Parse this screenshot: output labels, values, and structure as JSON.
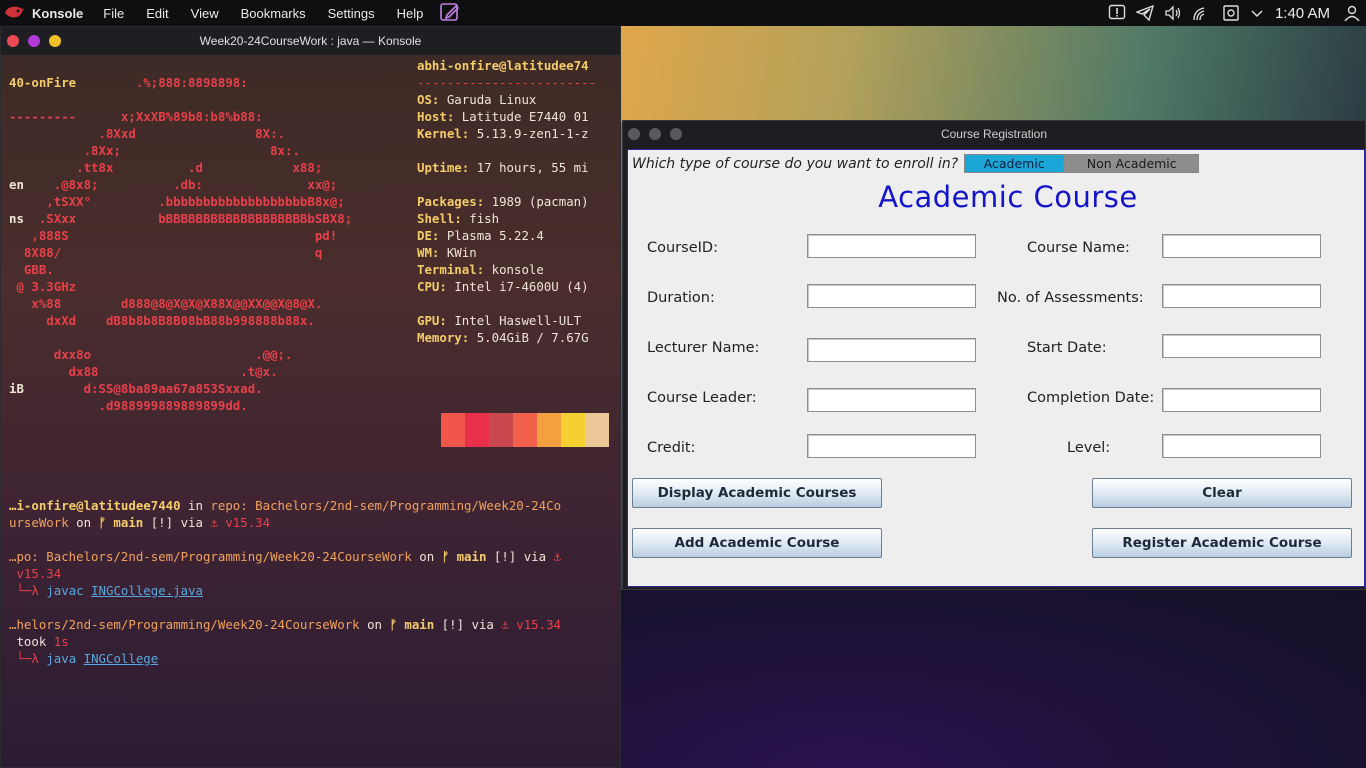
{
  "topbar": {
    "app_name": "Konsole",
    "menus": [
      "File",
      "Edit",
      "View",
      "Bookmarks",
      "Settings",
      "Help"
    ],
    "clock": "1:40 AM"
  },
  "konsole": {
    "title": "Week20-24CourseWork : java — Konsole",
    "ascii_art": "\n                 .%;888:8898898:\n\n               x;XxXB%89b8:b8%b88:\n            .8Xxd                8X:.\n          .8Xx;                    8x:.\n         .tt8x          .d            x88;\n      .@8x8;          .db:              xx@;\n     ,tSXX°         .bbbbbbbbbbbbbbbbbbbB8x@;\n    .SXxx           bBBBBBBBBBBBBBBBBBBBbSBX8;\n   ,888S                                 pd!\n  8X88/                                  q\n  GBB.\n @ 3.3GHz\n   x%88        d888@8@X@X@X88X@@XX@@X@8@X.\n     dxXd    dB8b8b8B8B08bB88b998888b88x.\n\n      dxx8o                      .@@;.\n        dx88                   .t@x.\n          d:SS@8ba89aa67a853Sxxad.\n            .d988999889889899dd.",
    "ascii_wrap": [
      "40-onFire",
      "---------",
      "en",
      "ns",
      "iB"
    ],
    "info": {
      "user": "abhi-onfire@latitudee74",
      "separator": "------------------------",
      "lines": [
        {
          "k": "OS",
          "v": " Garuda Linux"
        },
        {
          "k": "Host",
          "v": " Latitude E7440 01"
        },
        {
          "k": "Kernel",
          "v": " 5.13.9-zen1-1-z"
        },
        {
          "k": "Uptime",
          "v": " 17 hours, 55 mi"
        },
        {
          "k": "Packages",
          "v": " 1989 (pacman)"
        },
        {
          "k": "Shell",
          "v": " fish"
        },
        {
          "k": "DE",
          "v": " Plasma 5.22.4"
        },
        {
          "k": "WM",
          "v": " KWin"
        },
        {
          "k": "Terminal",
          "v": " konsole"
        },
        {
          "k": "CPU",
          "v": " Intel i7-4600U (4)"
        },
        {
          "k": "GPU",
          "v": " Intel Haswell-ULT"
        },
        {
          "k": "Memory",
          "v": " 5.04GiB / 7.67G"
        }
      ]
    },
    "palette": [
      "#f0574a",
      "#e8304a",
      "#c8484d",
      "#f0604a",
      "#f2a040",
      "#f5d030",
      "#ecc898"
    ],
    "prompt1_a": "…i-onfire@latitudee7440",
    "prompt1_b": " in ",
    "prompt1_c": "repo: Bachelors/2nd-sem/Programming/Week20-24Co",
    "prompt1_d": "urseWork",
    "prompt1_e": " on ",
    "prompt1_f": "ᚠ main",
    "prompt1_g": " [!] via ",
    "prompt1_h": "⚓ v15.34",
    "prompt2_a": "…po: Bachelors/2nd-sem/Programming/Week20-24CourseWork",
    "prompt2_b": " on ",
    "prompt2_c": "ᚠ main",
    "prompt2_d": " [!] via ",
    "prompt2_e": "⚓",
    "prompt2_f": " v15.34",
    "cmd1_prefix": " └─λ ",
    "cmd1_cmd": "javac",
    "cmd1_arg": "INGCollege.java",
    "prompt3_a": "…helors/2nd-sem/Programming/Week20-24CourseWork",
    "prompt3_b": " on ",
    "prompt3_c": "ᚠ main",
    "prompt3_d": " [!] via ",
    "prompt3_e": "⚓ v15.34",
    "took_a": " took ",
    "took_b": "1s",
    "cmd2_prefix": " └─λ ",
    "cmd2_cmd": "java",
    "cmd2_arg": "INGCollege"
  },
  "course_app": {
    "title": "Course Registration",
    "question": "Which type of course do you want to enroll in?",
    "tabs": [
      "Academic",
      "Non Academic"
    ],
    "heading": "Academic Course",
    "left_labels": [
      "CourseID:",
      "Duration:",
      "Lecturer Name:",
      "Course Leader:",
      "Credit:"
    ],
    "right_labels": [
      "Course Name:",
      "No. of Assessments:",
      "Start Date:",
      "Completion Date:",
      "Level:"
    ],
    "buttons": {
      "display": "Display Academic Courses",
      "clear": "Clear",
      "add": "Add Academic Course",
      "register": "Register Academic Course"
    }
  },
  "colors": {
    "tab_active": "#1aa6d6",
    "heading": "#1515c8"
  }
}
